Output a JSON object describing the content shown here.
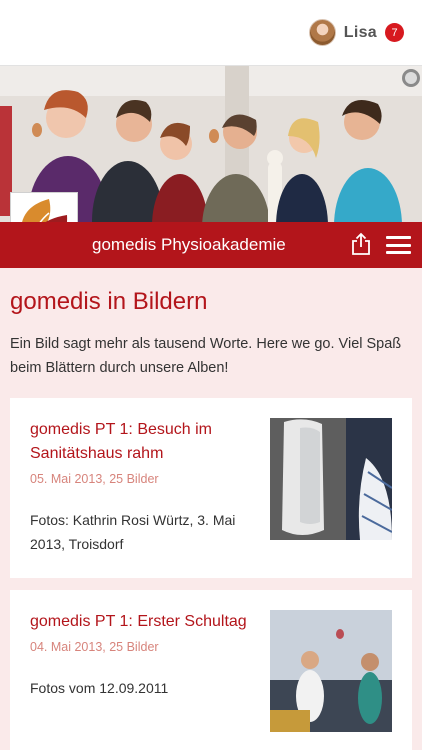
{
  "header": {
    "user_name": "Lisa",
    "notification_count": "7"
  },
  "hero": {
    "brand": "gomedis Physioakademie",
    "accent": "#b3151b"
  },
  "page": {
    "title": "gomedis in Bildern",
    "intro": "Ein Bild sagt mehr als tausend Worte. Here we go. Viel Spaß beim Blättern durch unsere Alben!"
  },
  "albums": [
    {
      "title": "gomedis PT 1: Besuch im Sanitätshaus rahm",
      "meta": "05. Mai 2013, 25 Bilder",
      "description": "Fotos: Kathrin Rosi Würtz, 3. Mai 2013, Troisdorf"
    },
    {
      "title": "gomedis PT 1: Erster Schultag",
      "meta": "04. Mai 2013, 25 Bilder",
      "description": "Fotos vom 12.09.2011"
    }
  ],
  "icons": {
    "share": "share-icon",
    "menu": "hamburger-menu-icon"
  }
}
